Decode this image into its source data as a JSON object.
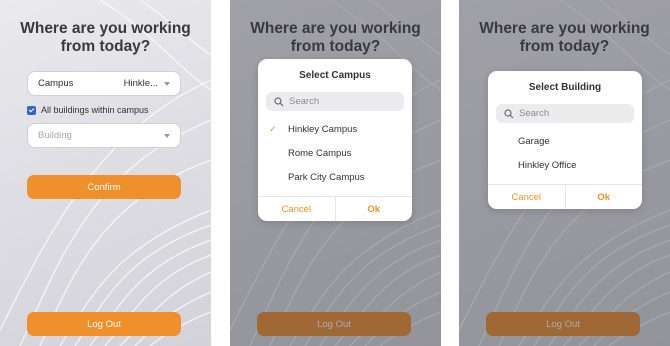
{
  "title_line1": "Where are you working",
  "title_line2": "from today?",
  "screen1": {
    "campus_label": "Campus",
    "campus_value": "Hinkle...",
    "checkbox_label": "All buildings within campus",
    "building_placeholder": "Building",
    "confirm_label": "Confirm"
  },
  "campus_modal": {
    "title": "Select Campus",
    "search_placeholder": "Search",
    "options": [
      "Hinkley Campus",
      "Rome Campus",
      "Park City Campus"
    ],
    "cancel": "Cancel",
    "ok": "Ok"
  },
  "building_modal": {
    "title": "Select Building",
    "search_placeholder": "Search",
    "options": [
      "Garage",
      "Hinkley Office"
    ],
    "cancel": "Cancel",
    "ok": "Ok"
  },
  "logout_label": "Log Out",
  "colors": {
    "accent": "#f0902a",
    "checkbox": "#3a63c7"
  }
}
